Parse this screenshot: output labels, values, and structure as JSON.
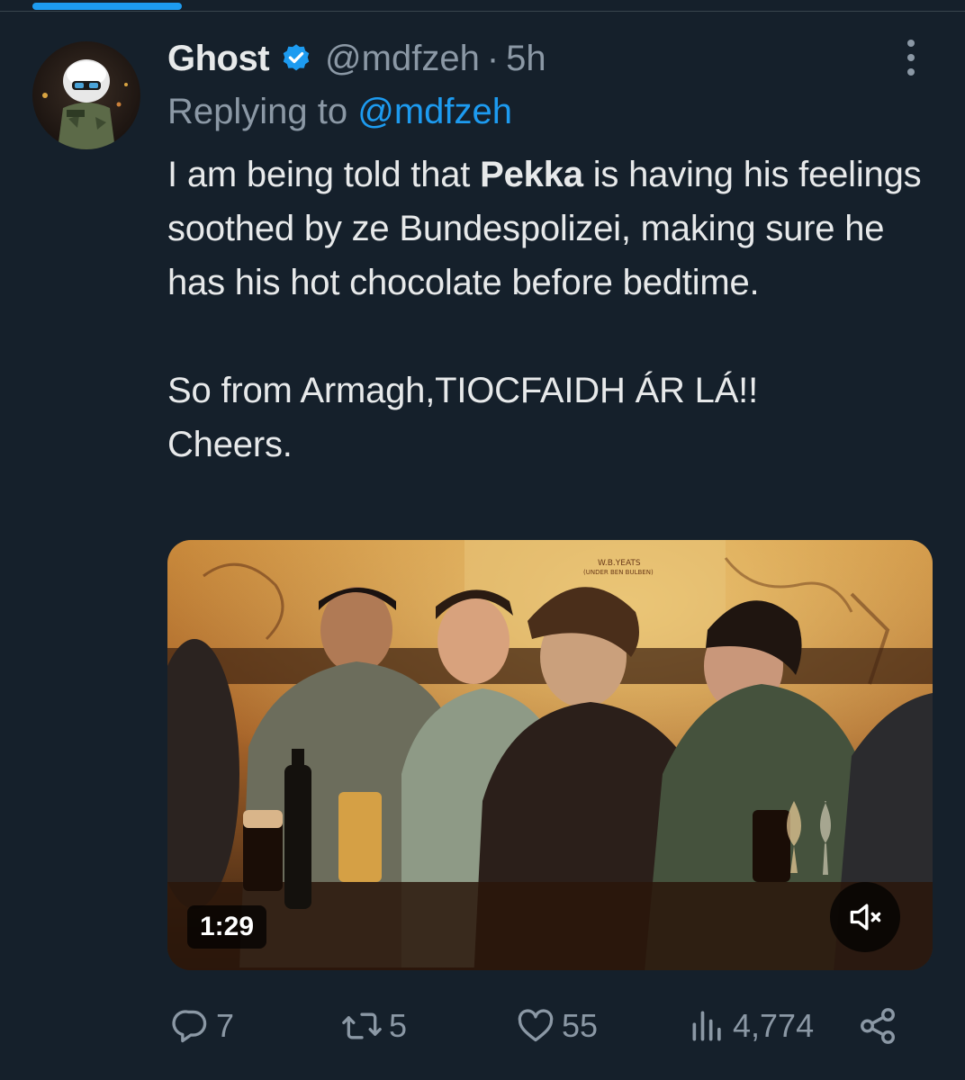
{
  "tweet": {
    "display_name": "Ghost",
    "handle": "@mdfzeh",
    "separator": "·",
    "time": "5h",
    "replying_prefix": "Replying to",
    "replying_to": "@mdfzeh",
    "text": {
      "line1_pre": "I am being told that ",
      "line1_bold": "Pekka",
      "line1_post": " is having his feelings soothed by ze Bundespolizei, making sure he has his hot chocolate before bedtime.",
      "paragraph2_line1": "So from Armagh,TIOCFAIDH ÁR LÁ!!",
      "paragraph2_line2": "Cheers."
    },
    "video": {
      "duration": "1:29",
      "sign_line1": "W.B.YEATS",
      "sign_line2": "(UNDER BEN BULBEN)"
    },
    "stats": {
      "replies": "7",
      "retweets": "5",
      "likes": "55",
      "views": "4,774"
    }
  },
  "colors": {
    "background": "#15202b",
    "text": "#e7e9ea",
    "secondary": "#8b98a5",
    "accent": "#1d9bf0"
  },
  "icons": {
    "more": "more-vertical-icon",
    "verified": "verified-badge-icon",
    "reply": "reply-icon",
    "retweet": "retweet-icon",
    "like": "heart-icon",
    "views": "views-chart-icon",
    "share": "share-icon",
    "mute": "mute-icon"
  }
}
